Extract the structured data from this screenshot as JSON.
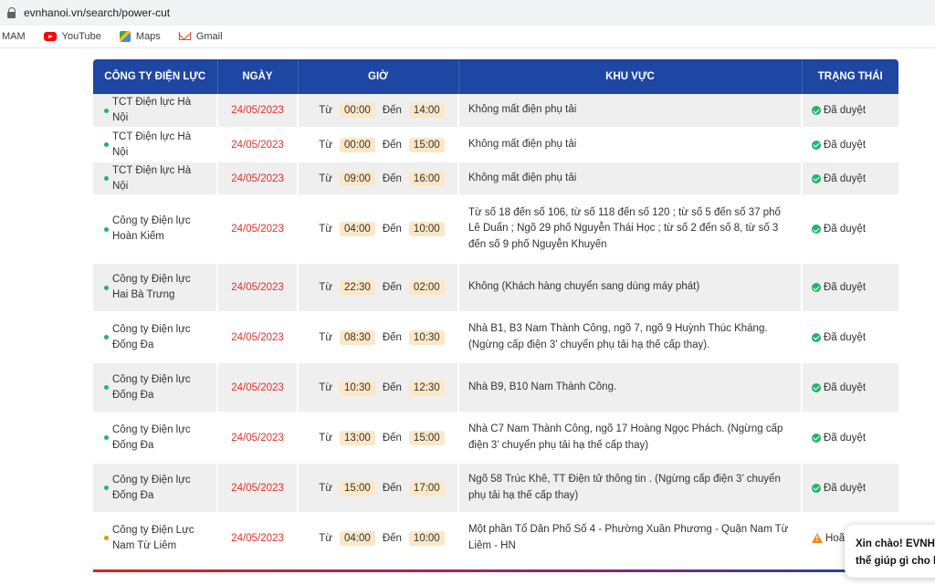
{
  "browser": {
    "url": "evnhanoi.vn/search/power-cut",
    "bookmarks": [
      "MAM",
      "YouTube",
      "Maps",
      "Gmail"
    ]
  },
  "table": {
    "headers": [
      "CÔNG TY ĐIỆN LỰC",
      "NGÀY",
      "GIỜ",
      "KHU VỰC",
      "TRẠNG THÁI"
    ],
    "from_label": "Từ",
    "to_label": "Đến",
    "rows": [
      {
        "company": "TCT Điện lực Hà Nội",
        "date": "24/05/2023",
        "from": "00:00",
        "to": "14:00",
        "area": "Không mất điện phụ tải",
        "status": "Đã duyệt",
        "status_type": "approved"
      },
      {
        "company": "TCT Điện lực Hà Nội",
        "date": "24/05/2023",
        "from": "00:00",
        "to": "15:00",
        "area": "Không mất điện phụ tải",
        "status": "Đã duyệt",
        "status_type": "approved"
      },
      {
        "company": "TCT Điện lực Hà Nội",
        "date": "24/05/2023",
        "from": "09:00",
        "to": "16:00",
        "area": "Không mất điện phụ tải",
        "status": "Đã duyệt",
        "status_type": "approved"
      },
      {
        "company": "Công ty Điện lực Hoàn Kiếm",
        "date": "24/05/2023",
        "from": "04:00",
        "to": "10:00",
        "area": "Từ số 18 đến số 106, từ số 118 đến số 120 ; từ số 5 đến số 37 phố Lê Duẩn ; Ngõ 29 phố Nguyễn Thái Học ; từ số 2 đến số 8, từ số 3 đến số 9 phố Nguyễn Khuyến",
        "status": "Đã duyệt",
        "status_type": "approved"
      },
      {
        "company": "Công ty Điện lực Hai Bà Trưng",
        "date": "24/05/2023",
        "from": "22:30",
        "to": "02:00",
        "area": "Không (Khách hàng chuyển sang dùng máy phát)",
        "status": "Đã duyệt",
        "status_type": "approved"
      },
      {
        "company": "Công ty Điện lực Đống Đa",
        "date": "24/05/2023",
        "from": "08:30",
        "to": "10:30",
        "area": "Nhà B1, B3 Nam Thành Công, ngõ 7, ngõ 9 Huỳnh Thúc Kháng. (Ngừng cấp điện 3’ chuyển phụ tải hạ thế cấp thay).",
        "status": "Đã duyệt",
        "status_type": "approved"
      },
      {
        "company": "Công ty Điện lực Đống Đa",
        "date": "24/05/2023",
        "from": "10:30",
        "to": "12:30",
        "area": "Nhà B9, B10 Nam Thành Công.",
        "status": "Đã duyệt",
        "status_type": "approved"
      },
      {
        "company": "Công ty Điện lực Đống Đa",
        "date": "24/05/2023",
        "from": "13:00",
        "to": "15:00",
        "area": "Nhà C7 Nam Thành Công, ngõ 17 Hoàng Ngọc Phách. (Ngừng cấp điện 3’ chuyển phụ tải hạ thế cấp thay)",
        "status": "Đã duyệt",
        "status_type": "approved"
      },
      {
        "company": "Công ty Điện lực Đống Đa",
        "date": "24/05/2023",
        "from": "15:00",
        "to": "17:00",
        "area": "Ngõ 58 Trúc Khê, TT Điện tử thông tin . (Ngừng cấp điện 3’ chuyển phụ tải hạ thế cấp thay)",
        "status": "Đã duyệt",
        "status_type": "approved"
      },
      {
        "company": "Công ty Điện Lực Nam Từ Liêm",
        "date": "24/05/2023",
        "from": "04:00",
        "to": "10:00",
        "area": "Một phần Tổ Dân Phố Số 4 - Phường Xuân Phương - Quận Nam Từ Liêm - HN",
        "status": "Hoãn",
        "status_type": "postponed"
      }
    ]
  },
  "chat": {
    "line1": "Xin chào! EVNHA",
    "line2": "thể giúp gì cho b"
  },
  "colors": {
    "header_bg": "#1e47a3",
    "date_red": "#e1322c",
    "approved_green": "#21b46b",
    "postponed_orange": "#f08c1b",
    "time_chip": "#fce7c6"
  }
}
